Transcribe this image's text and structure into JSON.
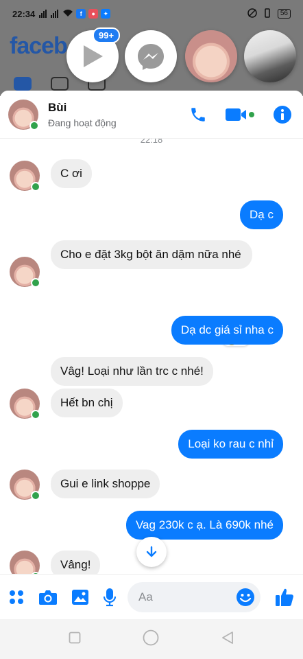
{
  "status_bar": {
    "time": "22:34",
    "battery": "56"
  },
  "background_app": {
    "logo_text": "faceb"
  },
  "chat_heads": {
    "badge": "99+"
  },
  "chat": {
    "contact_name": "Bùi",
    "contact_status": "Đang hoạt động",
    "timestamp": "22:18",
    "messages": [
      {
        "dir": "in",
        "text": "C ơi"
      },
      {
        "dir": "out",
        "text": "Dạ c"
      },
      {
        "dir": "in",
        "text": "Cho e đặt 3kg bột ăn dặm nữa nhé"
      },
      {
        "dir": "out",
        "text": "Dạ dc giá sỉ nha c"
      },
      {
        "dir": "in",
        "text": "Vâg! Loại như lần trc c nhé!"
      },
      {
        "dir": "in",
        "text": "Hết bn chị"
      },
      {
        "dir": "out",
        "text": "Loại ko rau c nhỉ"
      },
      {
        "dir": "in",
        "text": "Gui e link shoppe"
      },
      {
        "dir": "out",
        "text": "Vag 230k c ạ. Là 690k nhé"
      },
      {
        "dir": "in",
        "text": "Vâng!"
      }
    ],
    "reaction": {
      "emoji": "heart-eyes",
      "count": "1"
    }
  },
  "composer": {
    "placeholder": "Aa"
  },
  "colors": {
    "accent": "#0A7CFF",
    "online": "#31A24C",
    "incoming_bubble": "#EEEEEE"
  }
}
